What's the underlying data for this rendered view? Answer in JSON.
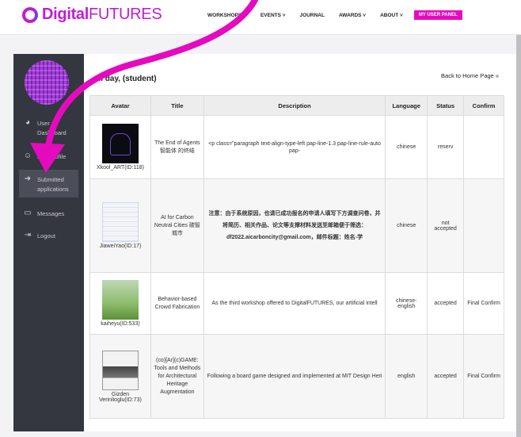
{
  "logo": {
    "text_bold": "Digital",
    "text_thin": "FUTURES"
  },
  "nav": {
    "items": [
      "WORKSHOPS ˅",
      "EVENTS ˅",
      "JOURNAL",
      "AWARDS ˅",
      "ABOUT ˅"
    ],
    "panel_button": "MY USER PANEL"
  },
  "sidebar": {
    "items": [
      {
        "label_line1": "User",
        "label_line2": "Dashboard",
        "icon": "dashboard-icon"
      },
      {
        "label_line1": "Edit Profile",
        "label_line2": "",
        "icon": "user-icon"
      },
      {
        "label_line1": "Submitted",
        "label_line2": "applications",
        "icon": "sign-in-icon"
      },
      {
        "label_line1": "Messages",
        "label_line2": "",
        "icon": "message-icon"
      },
      {
        "label_line1": "Logout",
        "label_line2": "",
        "icon": "logout-icon"
      }
    ]
  },
  "main": {
    "greeting": "Hi day, (student)",
    "back_link": "Back to Home Page «",
    "columns": [
      "Avatar",
      "Title",
      "Description",
      "Language",
      "Status",
      "Confirm"
    ],
    "rows": [
      {
        "avatar_caption": "Xkool_ART(ID:118)",
        "title": "The End of Agents 智能体 的终结",
        "description": "<p class=\"paragraph text-align-type-left pap-line-1.3 pap-line-rule-auto pap-",
        "language": "chinese",
        "status": "reserv",
        "confirm": ""
      },
      {
        "avatar_caption": "JiaweiYao(ID:17)",
        "title": "AI for Carbon Neutral Cities 碳智城市",
        "description": "注意：由于系统原因，也请已成功报名的申请人填写下方调查问卷，并将简历、相关作品、论文等支撑材料发送至邮箱便于筛选：df2022.aicarboncity@gmail.com，邮件标题：姓名-学",
        "language": "chinese",
        "status": "not accepted",
        "confirm": ""
      },
      {
        "avatar_caption": "kaiheyu(ID:533)",
        "title": "Behavior-based Crowd Fabrication",
        "description": "As the third workshop offered to DigitalFUTURES, our artificial intell",
        "language": "chinese-english",
        "status": "accepted",
        "confirm": "Final Confirm"
      },
      {
        "avatar_caption": "Gizden Verinlioglu(ID:73)",
        "title": "(co)[Ar](c)GAME: Tools and Methods for Architectural Heritage Augmentation",
        "description": "Following a board game designed and implemented at MIT Design Heri",
        "language": "english",
        "status": "accepted",
        "confirm": "Final Confirm"
      }
    ]
  },
  "colors": {
    "brand": "#c21bd6",
    "accent_button": "#e60abf",
    "sidebar_bg": "#343640",
    "annotation_arrow": "#e60abf"
  }
}
